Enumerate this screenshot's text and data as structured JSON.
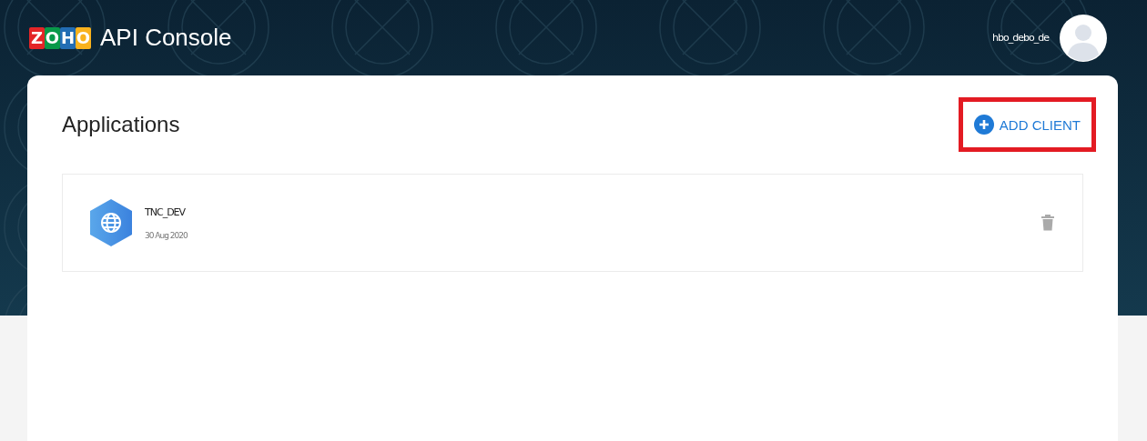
{
  "header": {
    "logo": "ZOHO",
    "title": "API Console",
    "user": {
      "name": "hbo_debo_de"
    }
  },
  "page": {
    "title": "Applications",
    "add_button": {
      "label": "ADD CLIENT",
      "highlighted": true
    }
  },
  "applications": [
    {
      "name": "TNC_DEV",
      "date": "30 Aug 2020"
    }
  ]
}
